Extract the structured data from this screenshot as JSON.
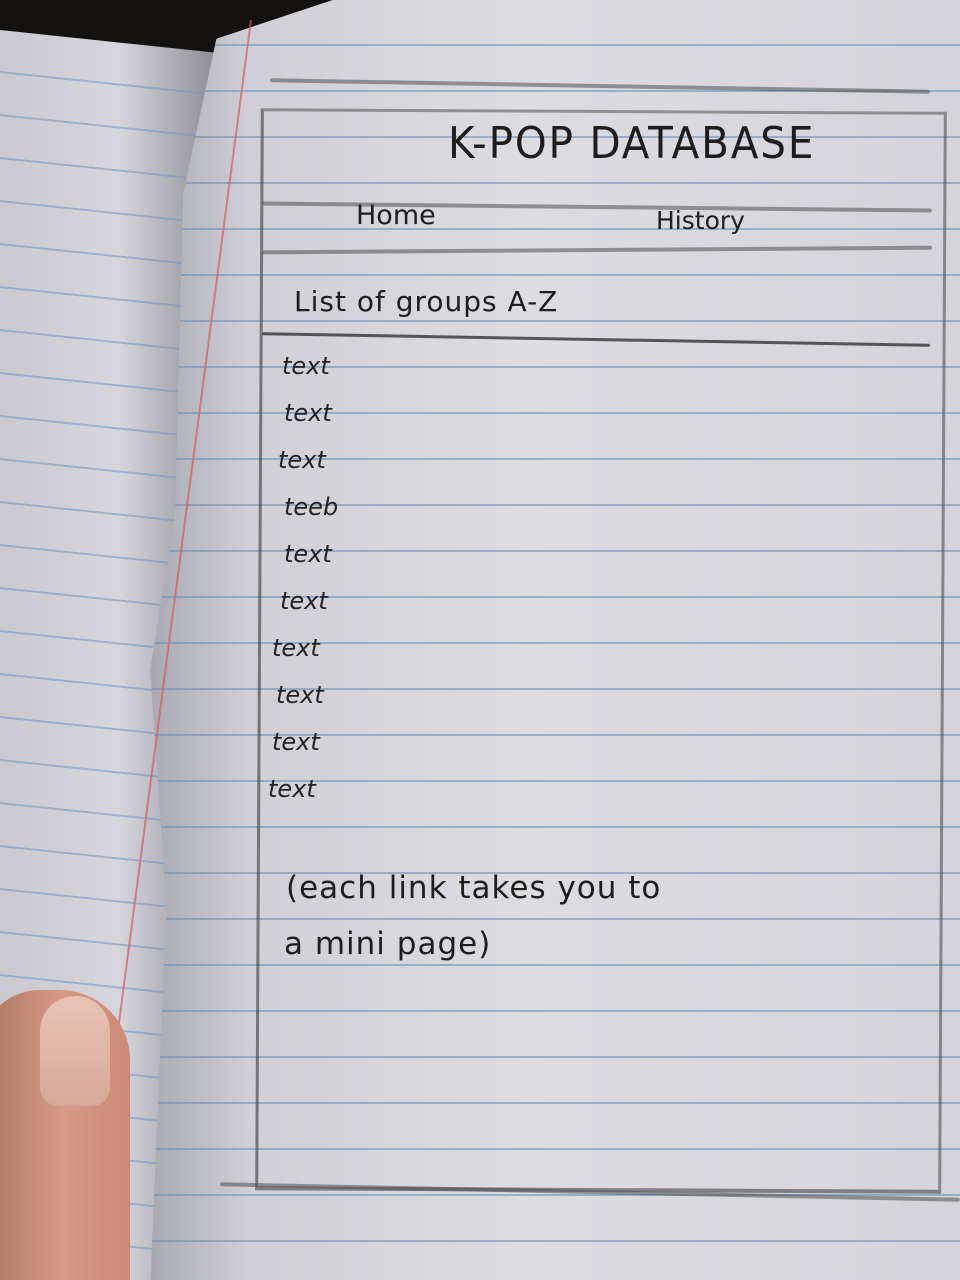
{
  "page": {
    "title": "K-POP DATABASE"
  },
  "nav": {
    "home_label": "Home",
    "history_label": "History"
  },
  "list": {
    "heading": "List of groups A-Z",
    "items": [
      "text",
      "text",
      "text",
      "teeb",
      "text",
      "text",
      "text",
      "text",
      "text",
      "text"
    ]
  },
  "note": {
    "line1": "(each link takes you to",
    "line2": "a mini page)"
  }
}
